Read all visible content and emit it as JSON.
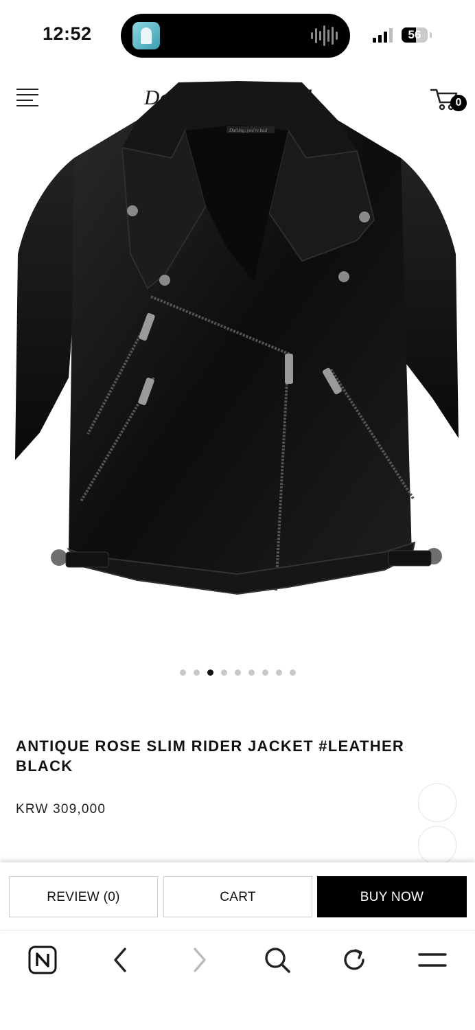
{
  "status_bar": {
    "time": "12:52",
    "battery_level": "56"
  },
  "header": {
    "menu_icon": "hamburger-menu-icon",
    "logo_text": "Darling, you're bad",
    "cart_icon": "cart-icon",
    "cart_count": "0"
  },
  "product": {
    "image_label": "Darling, you're bad",
    "title": "ANTIQUE ROSE SLIM RIDER JACKET #LEATHER BLACK",
    "price": "KRW 309,000"
  },
  "carousel": {
    "dots_count": 9,
    "active_index": 2
  },
  "actions": {
    "review_label": "REVIEW (0)",
    "cart_label": "CART",
    "buy_label": "BUY NOW"
  },
  "browser_bar": {
    "icons": [
      "naver-home-icon",
      "back-arrow-icon",
      "forward-arrow-icon",
      "search-icon",
      "reload-icon",
      "menu-icon"
    ]
  },
  "colors": {
    "primary": "#000000",
    "background": "#ffffff",
    "border": "#cfcfcf"
  }
}
